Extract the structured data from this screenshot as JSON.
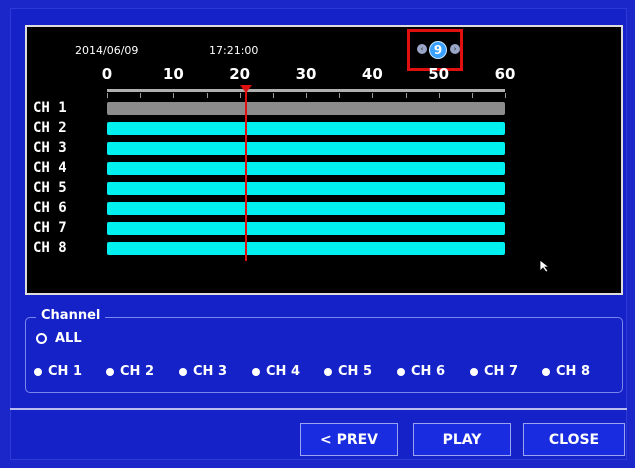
{
  "header": {
    "date": "2014/06/09",
    "time": "17:21:00"
  },
  "hour_nav": {
    "prev_glyph": "‹",
    "next_glyph": "›",
    "dial_glyph": "9",
    "icon": "hour-dial-icon"
  },
  "timeline": {
    "ticks": [
      "0",
      "10",
      "20",
      "30",
      "40",
      "50",
      "60"
    ],
    "cursor_minute": 21,
    "channels": [
      {
        "label": "CH 1",
        "color": "#8c8c8c"
      },
      {
        "label": "CH 2",
        "color": "#00f0f0"
      },
      {
        "label": "CH 3",
        "color": "#00f0f0"
      },
      {
        "label": "CH 4",
        "color": "#00f0f0"
      },
      {
        "label": "CH 5",
        "color": "#00f0f0"
      },
      {
        "label": "CH 6",
        "color": "#00f0f0"
      },
      {
        "label": "CH 7",
        "color": "#00f0f0"
      },
      {
        "label": "CH 8",
        "color": "#00f0f0"
      }
    ]
  },
  "channel_select": {
    "legend": "Channel",
    "all_label": "ALL",
    "options": [
      "CH 1",
      "CH 2",
      "CH 3",
      "CH 4",
      "CH 5",
      "CH 6",
      "CH 7",
      "CH 8"
    ]
  },
  "buttons": {
    "prev": "< PREV",
    "play": "PLAY",
    "close": "CLOSE"
  },
  "colors": {
    "background": "#1c27c9",
    "cursor": "#e01010",
    "recorded": "#00f0f0",
    "no_record": "#8c8c8c"
  }
}
